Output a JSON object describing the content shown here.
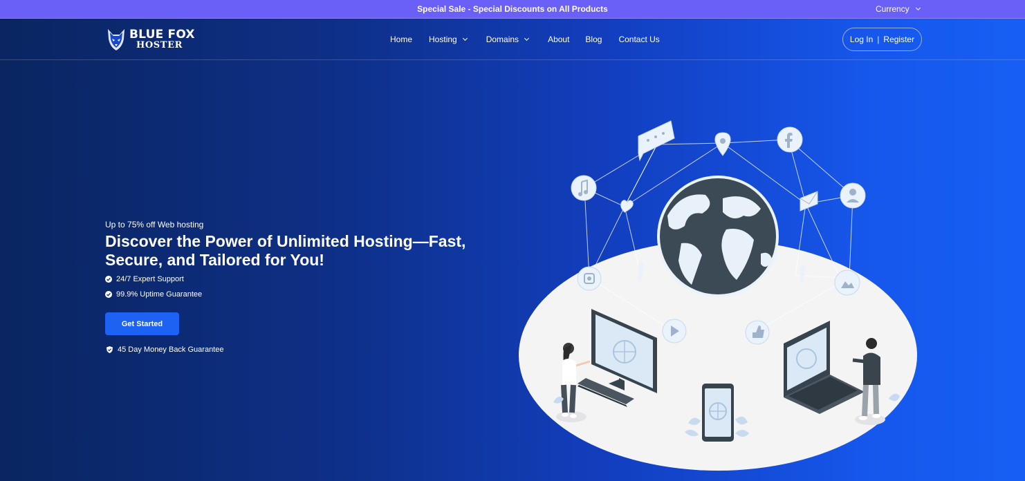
{
  "topbar": {
    "announcement": "Special Sale - Special Discounts on All Products",
    "currency_label": "Currency"
  },
  "header": {
    "logo": {
      "line1": "BLUE FOX",
      "line2": "HOSTER"
    },
    "nav": [
      {
        "label": "Home",
        "has_dropdown": false
      },
      {
        "label": "Hosting",
        "has_dropdown": true
      },
      {
        "label": "Domains",
        "has_dropdown": true
      },
      {
        "label": "About",
        "has_dropdown": false
      },
      {
        "label": "Blog",
        "has_dropdown": false
      },
      {
        "label": "Contact Us",
        "has_dropdown": false
      }
    ],
    "auth": {
      "login": "Log In",
      "separator": "|",
      "register": "Register"
    }
  },
  "hero": {
    "promo": "Up to 75% off Web hosting",
    "headline_line1": "Discover the Power of Unlimited Hosting—Fast,",
    "headline_line2": "Secure, and Tailored for You!",
    "features": [
      "24/7 Expert Support",
      "99.9% Uptime Guarantee"
    ],
    "cta_label": "Get Started",
    "guarantee": "45 Day Money Back Guarantee",
    "illustration": "isometric-web-hosting-globe-network"
  },
  "colors": {
    "topbar_bg": "#6a60f7",
    "hero_gradient_start": "#0a2560",
    "hero_gradient_end": "#175ff4",
    "cta_bg": "#1d62f3"
  }
}
